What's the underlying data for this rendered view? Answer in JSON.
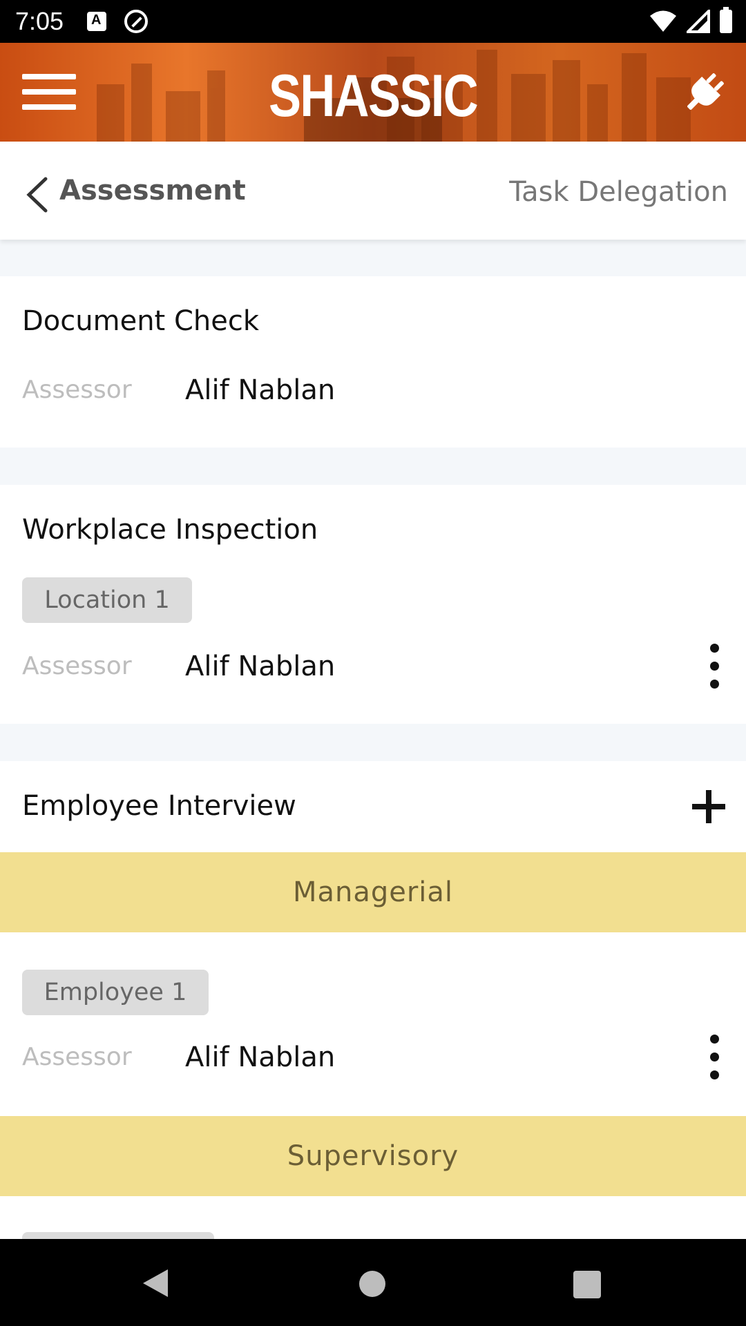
{
  "status_bar": {
    "time": "7:05"
  },
  "header": {
    "title": "SHASSIC"
  },
  "nav": {
    "back_label": "Assessment",
    "right_label": "Task Delegation"
  },
  "document_check": {
    "title": "Document Check",
    "assessor_label": "Assessor",
    "assessor_value": "Alif Nablan"
  },
  "workplace_inspection": {
    "title": "Workplace Inspection",
    "tag": "Location 1",
    "assessor_label": "Assessor",
    "assessor_value": "Alif Nablan"
  },
  "employee_interview": {
    "title": "Employee Interview",
    "sections": [
      {
        "label": "Managerial",
        "tag": "Employee 1",
        "assessor_label": "Assessor",
        "assessor_value": "Alif Nablan"
      },
      {
        "label": "Supervisory"
      }
    ]
  },
  "colors": {
    "header_orange": "#d4661f",
    "section_band": "#f2df90",
    "section_text": "#6b5e35"
  },
  "icons": [
    "menu-icon",
    "plug-icon",
    "back-icon",
    "kebab-icon",
    "plus-icon",
    "wifi-icon",
    "signal-icon",
    "battery-icon"
  ]
}
